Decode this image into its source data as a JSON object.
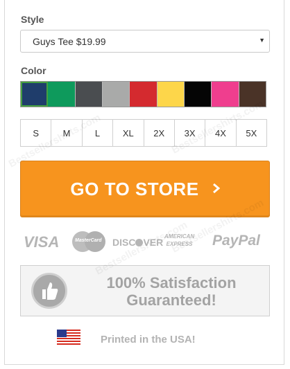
{
  "style": {
    "label": "Style",
    "selected": "Guys Tee $19.99"
  },
  "color": {
    "label": "Color",
    "swatches": [
      {
        "name": "navy",
        "hex": "#1f3d6b",
        "selected": true
      },
      {
        "name": "kelly-green",
        "hex": "#0e9a5c"
      },
      {
        "name": "charcoal-heather",
        "hex": "#4a4d50"
      },
      {
        "name": "heather-grey",
        "hex": "#a9aaa9"
      },
      {
        "name": "red",
        "hex": "#d42a2f"
      },
      {
        "name": "yellow",
        "hex": "#fdd64a"
      },
      {
        "name": "black",
        "hex": "#050505"
      },
      {
        "name": "hot-pink",
        "hex": "#ef3e8e"
      },
      {
        "name": "brown",
        "hex": "#4a3327"
      }
    ]
  },
  "sizes": [
    "S",
    "M",
    "L",
    "XL",
    "2X",
    "3X",
    "4X",
    "5X"
  ],
  "cta": {
    "label": "GO TO STORE",
    "arrow": "›",
    "color": "#f7941e"
  },
  "payments": {
    "visa": "VISA",
    "mastercard": "MasterCard",
    "discover_a": "DISC",
    "discover_b": "VER",
    "amex_1": "AMERICAN",
    "amex_2": "EXPRESS",
    "paypal": "PayPal"
  },
  "guarantee": {
    "line1": "100% Satisfaction",
    "line2": "Guaranteed!"
  },
  "made_in": {
    "text": "Printed in the USA!"
  },
  "watermark": "Bestsellershirts.com"
}
